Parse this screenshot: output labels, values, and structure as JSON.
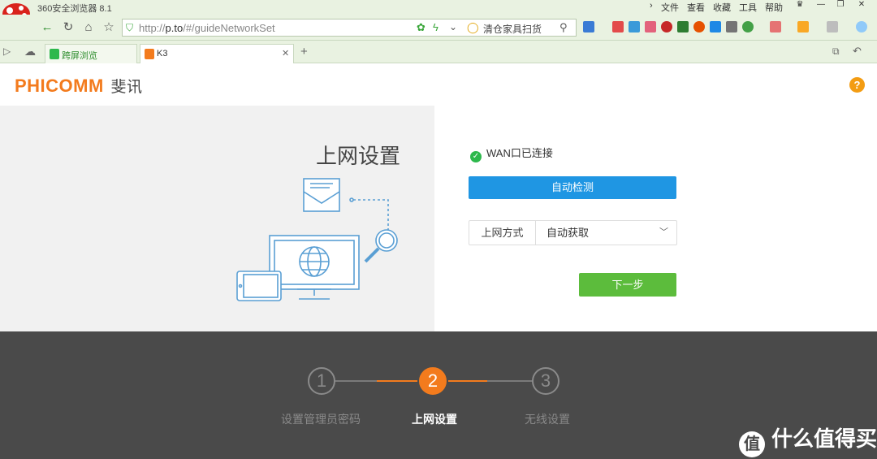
{
  "browser": {
    "title": "360安全浏览器 8.1",
    "menu": [
      "文件",
      "查看",
      "收藏",
      "工具",
      "帮助"
    ],
    "url_prefix": "http://",
    "url_host": "p.to",
    "url_path": "/#/guideNetworkSet",
    "search_text": "清仓家具扫货",
    "tabs": [
      {
        "label": "跨屏浏览",
        "active": false
      },
      {
        "label": "K3",
        "active": true
      }
    ],
    "new_tab": "+"
  },
  "header": {
    "brand": "PHICOMM",
    "brand_cn": "斐讯",
    "help": "?"
  },
  "left": {
    "title": "上网设置"
  },
  "right": {
    "wan_status": "WAN口已连接",
    "detect_button": "自动检测",
    "mode_label": "上网方式",
    "mode_value": "自动获取",
    "next_button": "下一步"
  },
  "steps": [
    {
      "num": "1",
      "label": "设置管理员密码",
      "active": false
    },
    {
      "num": "2",
      "label": "上网设置",
      "active": true
    },
    {
      "num": "3",
      "label": "无线设置",
      "active": false
    }
  ],
  "watermark": {
    "icon": "值",
    "text": "什么值得买"
  },
  "colors": {
    "brand": "#f37b1d",
    "primary": "#1f96e3",
    "success": "#5cbc3c",
    "footer": "#4a4a4a"
  }
}
